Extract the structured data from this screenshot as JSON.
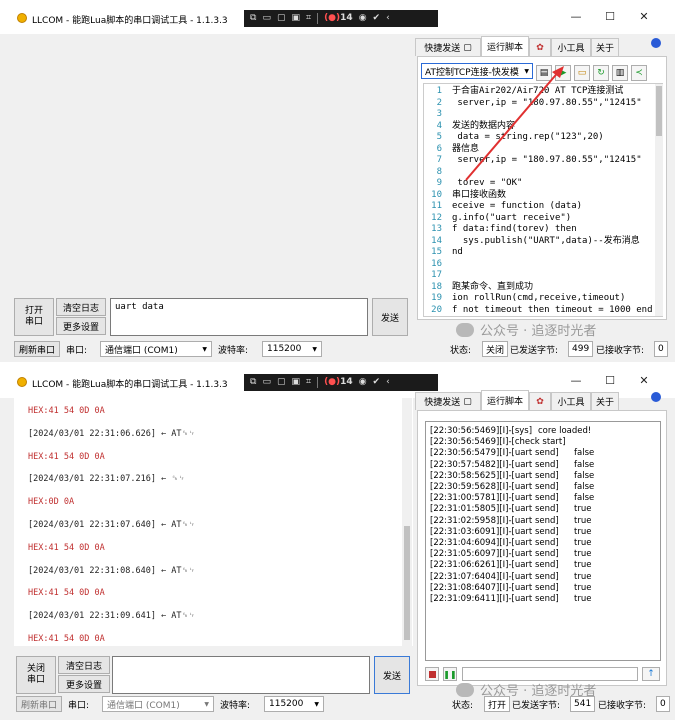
{
  "window1": {
    "title": "LLCOM - 能跑Lua脚本的串口调试工具 - 1.1.3.3",
    "rec_count": "14",
    "tabs": [
      "快捷发送",
      "运行脚本",
      "小工具",
      "关于"
    ],
    "script_select": "AT控制TCP连接-快发模",
    "editor_lines": [
      {
        "n": "1",
        "code": "于合宙Air202/Air720 AT TCP连接测试"
      },
      {
        "n": "2",
        "code": " server,ip = \"180.97.80.55\",\"12415\""
      },
      {
        "n": "3",
        "code": ""
      },
      {
        "n": "4",
        "code": "发送的数据内容"
      },
      {
        "n": "5",
        "code": " data = string.rep(\"123\",20)"
      },
      {
        "n": "6",
        "code": "器信息"
      },
      {
        "n": "7",
        "code": " server,ip = \"180.97.80.55\",\"12415\""
      },
      {
        "n": "8",
        "code": ""
      },
      {
        "n": "9",
        "code": " torev = \"OK\""
      },
      {
        "n": "10",
        "code": "串口接收函数"
      },
      {
        "n": "11",
        "code": "eceive = function (data)"
      },
      {
        "n": "12",
        "code": "g.info(\"uart receive\")"
      },
      {
        "n": "13",
        "code": "f data:find(torev) then"
      },
      {
        "n": "14",
        "code": "  sys.publish(\"UART\",data)--发布消息"
      },
      {
        "n": "15",
        "code": "nd"
      },
      {
        "n": "16",
        "code": ""
      },
      {
        "n": "17",
        "code": ""
      },
      {
        "n": "18",
        "code": "跑某命令、直到成功"
      },
      {
        "n": "19",
        "code": "ion rollRun(cmd,receive,timeout)"
      },
      {
        "n": "20",
        "code": "f not timeout then timeout = 1000 end"
      }
    ],
    "open_button": "打开\n串口",
    "clear_log": "清空日志",
    "more_settings": "更多设置",
    "send_input": "uart data",
    "send_button": "发送",
    "status": {
      "refresh": "刷新串口",
      "port_label": "串口:",
      "port_value": "通信端口 (COM1)",
      "baud_label": "波特率:",
      "baud_value": "115200",
      "state_label": "状态:",
      "state_value": "关闭",
      "sent_label": "已发送字节:",
      "sent_value": "499",
      "recv_label": "已接收字节:",
      "recv_value": "0"
    }
  },
  "window2": {
    "title": "LLCOM - 能跑Lua脚本的串口调试工具 - 1.1.3.3",
    "rec_count": "14",
    "tabs": [
      "快捷发送",
      "运行脚本",
      "小工具",
      "关于"
    ],
    "log": [
      {
        "kind": "hex",
        "text": "HEX:41 54 0D 0A"
      },
      {
        "kind": "ts",
        "text": "[2024/03/01 22:31:06.626] ← AT␍␊"
      },
      {
        "kind": "hex",
        "text": "HEX:41 54 0D 0A"
      },
      {
        "kind": "ts",
        "text": "[2024/03/01 22:31:07.216] ← ␍␊"
      },
      {
        "kind": "hex",
        "text": "HEX:0D 0A"
      },
      {
        "kind": "ts",
        "text": "[2024/03/01 22:31:07.640] ← AT␍␊"
      },
      {
        "kind": "hex",
        "text": "HEX:41 54 0D 0A"
      },
      {
        "kind": "ts",
        "text": "[2024/03/01 22:31:08.640] ← AT␍␊"
      },
      {
        "kind": "hex",
        "text": "HEX:41 54 0D 0A"
      },
      {
        "kind": "ts",
        "text": "[2024/03/01 22:31:09.641] ← AT␍␊"
      },
      {
        "kind": "hex",
        "text": "HEX:41 54 0D 0A"
      }
    ],
    "console": [
      {
        "t": "[22:30:56:5469][I]-[sys]",
        "v": "core loaded!",
        "gap": true
      },
      {
        "t": "[22:30:56:5469][I]-[check start]",
        "v": ""
      },
      {
        "t": "[22:30:56:5479][I]-[uart send]",
        "v": "false"
      },
      {
        "t": "[22:30:57:5482][I]-[uart send]",
        "v": "false"
      },
      {
        "t": "[22:30:58:5625][I]-[uart send]",
        "v": "false"
      },
      {
        "t": "[22:30:59:5628][I]-[uart send]",
        "v": "false"
      },
      {
        "t": "[22:31:00:5781][I]-[uart send]",
        "v": "false"
      },
      {
        "t": "[22:31:01:5805][I]-[uart send]",
        "v": "true"
      },
      {
        "t": "[22:31:02:5958][I]-[uart send]",
        "v": "true"
      },
      {
        "t": "[22:31:03:6091][I]-[uart send]",
        "v": "true"
      },
      {
        "t": "[22:31:04:6094][I]-[uart send]",
        "v": "true"
      },
      {
        "t": "[22:31:05:6097][I]-[uart send]",
        "v": "true"
      },
      {
        "t": "[22:31:06:6261][I]-[uart send]",
        "v": "true"
      },
      {
        "t": "[22:31:07:6404][I]-[uart send]",
        "v": "true"
      },
      {
        "t": "[22:31:08:6407][I]-[uart send]",
        "v": "true"
      },
      {
        "t": "[22:31:09:6411][I]-[uart send]",
        "v": "true"
      }
    ],
    "close_button": "关闭\n串口",
    "clear_log": "清空日志",
    "more_settings": "更多设置",
    "send_input": "",
    "send_button": "发送",
    "status": {
      "refresh": "刷新串口",
      "port_label": "串口:",
      "port_value": "通信端口 (COM1)",
      "baud_label": "波特率:",
      "baud_value": "115200",
      "state_label": "状态:",
      "state_value": "打开",
      "sent_label": "已发送字节:",
      "sent_value": "541",
      "recv_label": "已接收字节:",
      "recv_value": "0"
    }
  },
  "watermark": "公众号 · 追逐时光者",
  "colors": {
    "accent_green": "#1a9a2a",
    "log_red": "#c03030",
    "arrow_red": "#e03030",
    "line_num": "#2b91af"
  }
}
